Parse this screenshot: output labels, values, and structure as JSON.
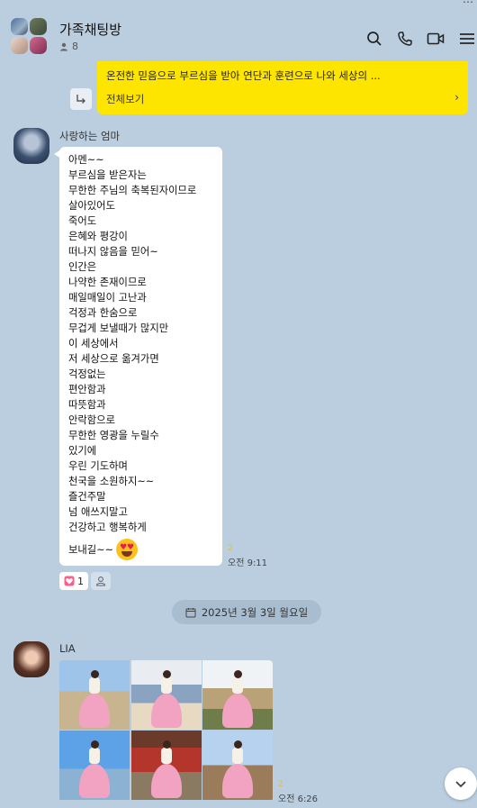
{
  "header": {
    "title": "가족채팅방",
    "member_count": "8",
    "icons": [
      "search-icon",
      "phone-icon",
      "video-icon",
      "menu-icon"
    ]
  },
  "notice": {
    "text": "온전한 믿음으로 부르심을 받아 연단과 훈련으로 나와 세상의 ...",
    "more_label": "전체보기"
  },
  "messages": [
    {
      "sender": "사랑하는 엄마",
      "lines": [
        "아멘~~",
        "부르심을 받은자는",
        "무한한 주님의 축복된자이므로",
        "살아있어도",
        "죽어도",
        "은혜와 평강이",
        "떠나지 않음을 믿어~",
        "인간은",
        "나약한 존재이므로",
        "매일매일이 고난과",
        "걱정과 한숨으로",
        "무겁게 보낼때가 많지만",
        "이 세상에서",
        "저 세상으로 옮겨가면",
        "걱정없는",
        "편안함과",
        "따뜻함과",
        "안락함으로",
        "무한한 영광을 누릴수",
        "있기에",
        "우린 기도하며",
        "천국을 소원하지~~",
        "즐건주말",
        "넘 애쓰지말고",
        "건강하고 행복하게"
      ],
      "last_line": "보내길~~",
      "unread": "2",
      "time": "오전 9:11",
      "reaction_count": "1"
    },
    {
      "sender": "LIA",
      "photo_count": 6,
      "unread": "2",
      "time": "오전 6:26"
    }
  ],
  "date_divider": "2025년 3월 3일 월요일",
  "colors": {
    "background": "#bacee0",
    "notice": "#fee500",
    "bubble": "#ffffff"
  }
}
